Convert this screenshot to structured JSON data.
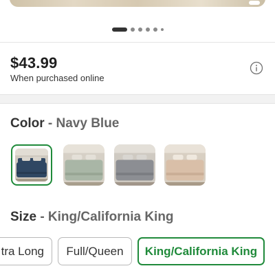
{
  "hero": {},
  "carousel": {
    "dots": [
      {
        "active": true
      },
      {},
      {},
      {},
      {},
      {
        "small": true
      }
    ]
  },
  "price": {
    "amount": "$43.99",
    "note": "When purchased online",
    "info_icon": "info-circle-icon"
  },
  "color": {
    "label": "Color",
    "separator": "-",
    "selected": "Navy Blue",
    "swatches": [
      {
        "name": "navy-blue-swatch",
        "bedding": "#2f4763",
        "selected": true
      },
      {
        "name": "sage-swatch",
        "bedding": "#a9b6a6"
      },
      {
        "name": "gray-swatch",
        "bedding": "#8c8e93"
      },
      {
        "name": "blush-swatch",
        "bedding": "#d9bfa8"
      }
    ]
  },
  "size": {
    "label": "Size",
    "separator": "-",
    "selected": "King/California King",
    "options": [
      "Twin/Twin Extra Long",
      "Full/Queen",
      "King/California King"
    ],
    "visible_labels": [
      "tra Long",
      "Full/Queen",
      "King/California King"
    ]
  },
  "colors": {
    "accent": "#1f8a3a",
    "dark": "#333333",
    "muted": "#666666",
    "border": "#b8b8b8"
  }
}
